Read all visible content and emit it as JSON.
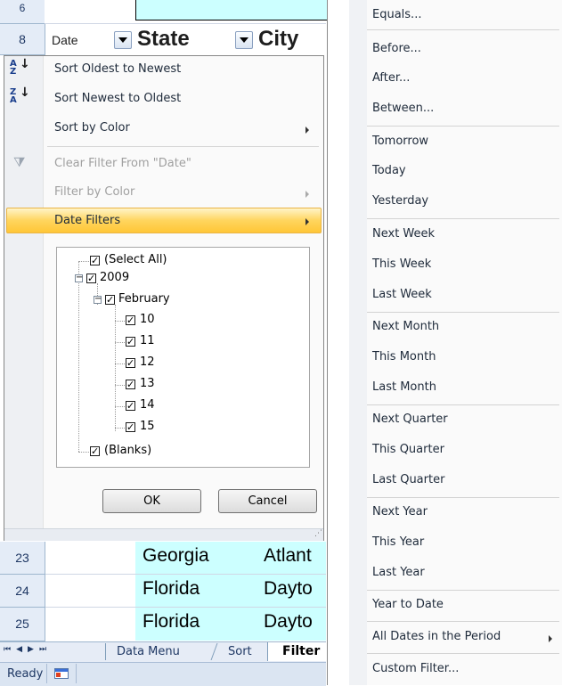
{
  "sheet": {
    "row_top_label": "6",
    "header_row_num": "8",
    "headers": {
      "date": "Date",
      "state": "State",
      "city": "City"
    },
    "rows": [
      {
        "num": "23",
        "state": "Georgia",
        "city": "Atlant"
      },
      {
        "num": "24",
        "state": "Florida",
        "city": "Dayto"
      },
      {
        "num": "25",
        "state": "Florida",
        "city": "Dayto"
      }
    ],
    "tabs": {
      "tab1": "Data Menu",
      "tab2": "Sort",
      "tab3": "Filter"
    },
    "nav_glyphs": {
      "first": "⏮",
      "prev": "◀",
      "next": "▶",
      "last": "⏭"
    },
    "status": "Ready"
  },
  "filter_menu": {
    "sort_asc": "Sort Oldest to Newest",
    "sort_desc": "Sort Newest to Oldest",
    "sort_color": "Sort by Color",
    "clear_filter": "Clear Filter From \"Date\"",
    "filter_color": "Filter by Color",
    "date_filters": "Date Filters",
    "tree": {
      "select_all": "(Select All)",
      "year": "2009",
      "month": "February",
      "days": [
        "10",
        "11",
        "12",
        "13",
        "14",
        "15"
      ],
      "blanks": "(Blanks)"
    },
    "ok": "OK",
    "cancel": "Cancel"
  },
  "date_submenu": {
    "groups": [
      [
        "Equals...",
        "Before...",
        "After...",
        "Between..."
      ],
      [
        "Tomorrow",
        "Today",
        "Yesterday"
      ],
      [
        "Next Week",
        "This Week",
        "Last Week"
      ],
      [
        "Next Month",
        "This Month",
        "Last Month"
      ],
      [
        "Next Quarter",
        "This Quarter",
        "Last Quarter"
      ],
      [
        "Next Year",
        "This Year",
        "Last Year"
      ],
      [
        "Year to Date"
      ],
      [
        "All Dates in the Period"
      ],
      [
        "Custom Filter..."
      ]
    ]
  },
  "colors": {
    "highlight": "#ffd55e",
    "cyan_cells": "#ccffff",
    "row_header": "#e4ecf7"
  }
}
